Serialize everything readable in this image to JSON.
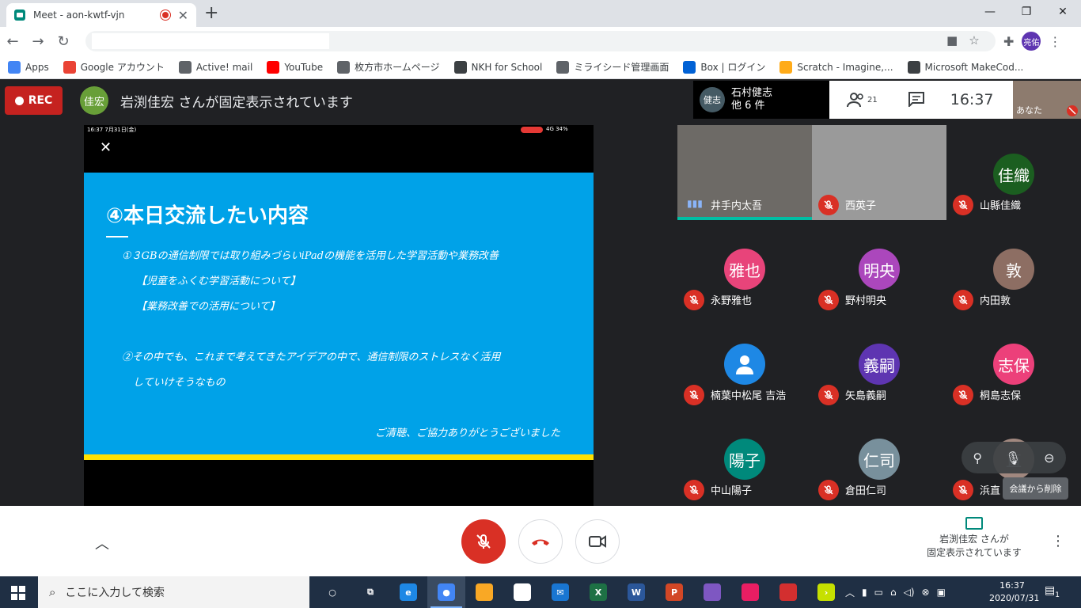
{
  "browser": {
    "tab_title": "Meet - aon-kwtf-vjn",
    "bookmarks": [
      {
        "label": "Apps",
        "icon": "apps-grid-icon",
        "color": "#4285f4"
      },
      {
        "label": "Google アカウント",
        "icon": "google-icon",
        "color": "#ea4335"
      },
      {
        "label": "Active! mail",
        "icon": "globe-icon",
        "color": "#5f6368"
      },
      {
        "label": "YouTube",
        "icon": "youtube-icon",
        "color": "#ff0000"
      },
      {
        "label": "枚方市ホームページ",
        "icon": "city-icon",
        "color": "#5f6368"
      },
      {
        "label": "NKH for School",
        "icon": "n-icon",
        "color": "#3c4043"
      },
      {
        "label": "ミライシード管理画面",
        "icon": "globe-icon",
        "color": "#5f6368"
      },
      {
        "label": "Box | ログイン",
        "icon": "box-icon",
        "color": "#0061d5"
      },
      {
        "label": "Scratch - Imagine,...",
        "icon": "scratch-icon",
        "color": "#ffab19"
      },
      {
        "label": "Microsoft MakeCod...",
        "icon": "makecode-icon",
        "color": "#3c4043"
      }
    ],
    "profile_initials": "亮佑"
  },
  "meet": {
    "rec_label": "REC",
    "pinned_avatar": "佳宏",
    "pinned_banner": "岩渕佳宏 さんが固定表示されています",
    "top_speaker": {
      "avatar": "健志",
      "name": "石村健志",
      "others": "他 6 件"
    },
    "participant_count": "21",
    "time": "16:37",
    "self_label": "あなた",
    "presentation": {
      "status_time": "16:37  7月31日(金)",
      "status_battery": "4G 34%",
      "slide": {
        "title": "④本日交流したい内容",
        "lines": [
          "①３GBの通信制限では取り組みづらいiPadの機能を活用した学習活動や業務改善",
          "【児童をふくむ学習活動について】",
          "【業務改善での活用について】",
          "②その中でも、これまで考えてきたアイデアの中で、通信制限のストレスなく活用",
          "していけそうなもの",
          "ご清聴、ご協力ありがとうございました"
        ]
      }
    },
    "tiles": [
      {
        "name": "井手内太吾",
        "avatar": "",
        "color": "#6d6a66",
        "video": true,
        "muted": false
      },
      {
        "name": "西英子",
        "avatar": "",
        "color": "#9a9a9a",
        "video": true,
        "muted": true
      },
      {
        "name": "山縣佳織",
        "avatar": "佳織",
        "color": "#1b5e20",
        "video": false,
        "muted": true
      },
      {
        "name": "永野雅也",
        "avatar": "雅也",
        "color": "#e8447a",
        "video": false,
        "muted": true
      },
      {
        "name": "野村明央",
        "avatar": "明央",
        "color": "#ab47bc",
        "video": false,
        "muted": true
      },
      {
        "name": "内田敦",
        "avatar": "敦",
        "color": "#8d6e63",
        "video": false,
        "muted": true
      },
      {
        "name": "楠葉中松尾 吉浩",
        "avatar": "",
        "color": "#1e88e5",
        "video": false,
        "muted": true
      },
      {
        "name": "矢島義嗣",
        "avatar": "義嗣",
        "color": "#5e35b1",
        "video": false,
        "muted": true
      },
      {
        "name": "桐島志保",
        "avatar": "志保",
        "color": "#ec407a",
        "video": false,
        "muted": true
      },
      {
        "name": "中山陽子",
        "avatar": "陽子",
        "color": "#00897b",
        "video": false,
        "muted": true
      },
      {
        "name": "倉田仁司",
        "avatar": "仁司",
        "color": "#78909c",
        "video": false,
        "muted": true
      },
      {
        "name": "浜直",
        "avatar": "直",
        "color": "#a1887f",
        "video": false,
        "muted": true
      }
    ],
    "tooltip": "会議から削除",
    "bottom_status": {
      "line1": "岩渕佳宏 さんが",
      "line2": "固定表示されています"
    }
  },
  "taskbar": {
    "search_placeholder": "ここに入力して検索",
    "time": "16:37",
    "date": "2020/07/31",
    "notif_count": "1",
    "apps": [
      {
        "icon": "cortana-icon",
        "color": "",
        "label": "○"
      },
      {
        "icon": "task-view-icon",
        "color": "",
        "label": "⧉"
      },
      {
        "icon": "edge-icon",
        "color": "#1e88e5",
        "label": "e"
      },
      {
        "icon": "chrome-icon",
        "color": "#4285f4",
        "label": "●"
      },
      {
        "icon": "folder-icon",
        "color": "#f9a825",
        "label": ""
      },
      {
        "icon": "store-icon",
        "color": "#ffffff",
        "label": ""
      },
      {
        "icon": "mail-icon",
        "color": "#1976d2",
        "label": "✉"
      },
      {
        "icon": "excel-icon",
        "color": "#1e7145",
        "label": "X"
      },
      {
        "icon": "word-icon",
        "color": "#2b579a",
        "label": "W"
      },
      {
        "icon": "powerpoint-icon",
        "color": "#d24726",
        "label": "P"
      },
      {
        "icon": "paint-icon",
        "color": "#7e57c2",
        "label": ""
      },
      {
        "icon": "3d-icon",
        "color": "#e91e63",
        "label": ""
      },
      {
        "icon": "acrobat-icon",
        "color": "#d32f2f",
        "label": ""
      },
      {
        "icon": "arrow-app-icon",
        "color": "#c6e000",
        "label": "›"
      }
    ]
  }
}
